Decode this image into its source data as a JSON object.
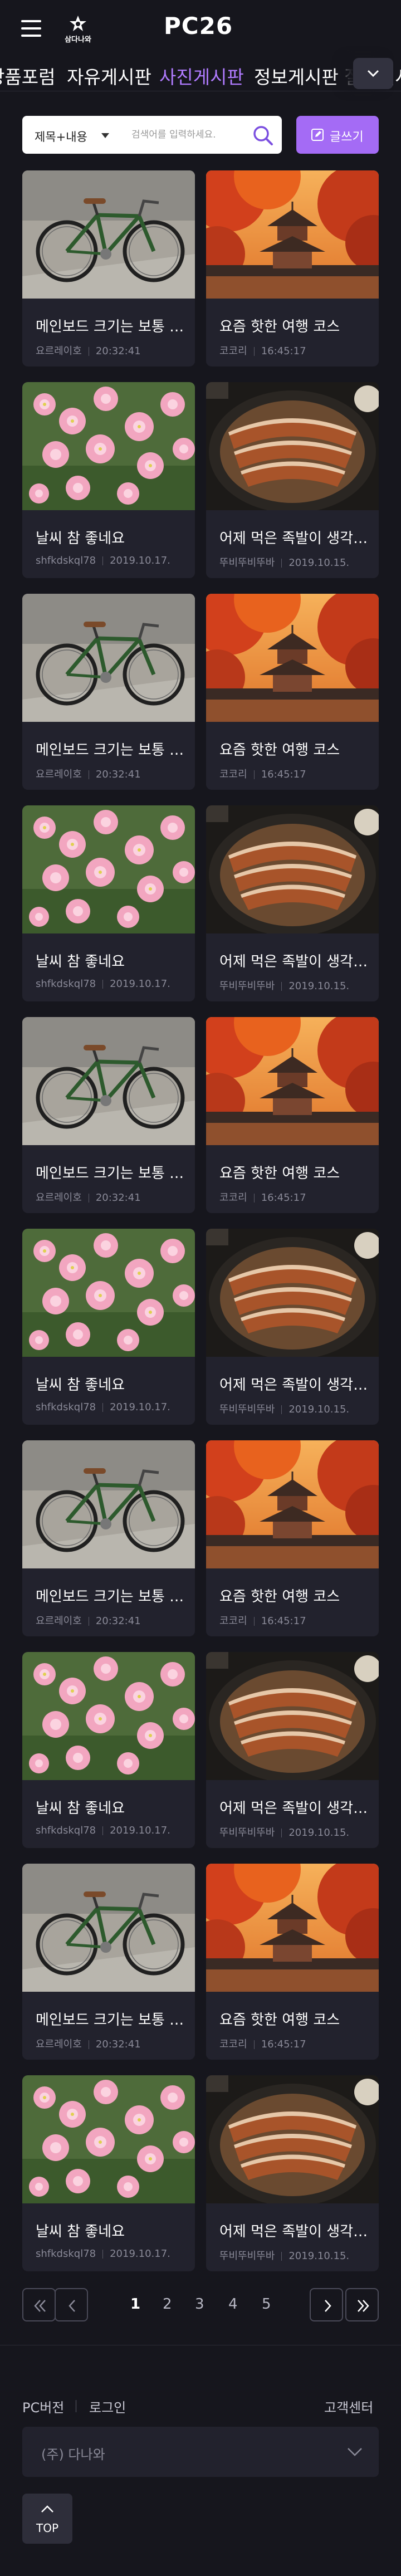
{
  "header": {
    "logo_text": "삼다나와",
    "brand": "PC26",
    "menu_icon": "hamburger-menu-icon",
    "logo_icon": "samdanawa-logo-icon"
  },
  "tabs": [
    {
      "label": "상품포럼",
      "active": false
    },
    {
      "label": "자유게시판",
      "active": false
    },
    {
      "label": "사진게시판",
      "active": true
    },
    {
      "label": "정보게시판",
      "active": false
    },
    {
      "label": "질문게시판",
      "active": false
    }
  ],
  "tab_toggle_icon": "chevron-down-icon",
  "search": {
    "select_value": "제목+내용",
    "placeholder": "검색어를 입력하세요.",
    "button_icon": "search-icon"
  },
  "write_button": {
    "label": "글쓰기",
    "icon": "pencil-icon"
  },
  "posts": [
    {
      "title": "메인보드 크기는 보통 어느 정도인가요",
      "author": "요르레이호",
      "date": "20:32:41",
      "image": "bicycle"
    },
    {
      "title": "요즘 핫한 여행 코스",
      "author": "코코리",
      "date": "16:45:17",
      "image": "autumn-pagoda"
    },
    {
      "title": "날씨 참 좋네요",
      "author": "shfkdskql78",
      "date": "2019.10.17.",
      "image": "pink-flowers"
    },
    {
      "title": "어제 먹은 족발이 생각나네요",
      "author": "뚜비뚜비뚜바",
      "date": "2019.10.15.",
      "image": "jokbal"
    },
    {
      "title": "메인보드 크기는 보통 어느 정도인가요",
      "author": "요르레이호",
      "date": "20:32:41",
      "image": "bicycle"
    },
    {
      "title": "요즘 핫한 여행 코스",
      "author": "코코리",
      "date": "16:45:17",
      "image": "autumn-pagoda"
    },
    {
      "title": "날씨 참 좋네요",
      "author": "shfkdskql78",
      "date": "2019.10.17.",
      "image": "pink-flowers"
    },
    {
      "title": "어제 먹은 족발이 생각나네요",
      "author": "뚜비뚜비뚜바",
      "date": "2019.10.15.",
      "image": "jokbal"
    },
    {
      "title": "메인보드 크기는 보통 어느 정도인가요",
      "author": "요르레이호",
      "date": "20:32:41",
      "image": "bicycle"
    },
    {
      "title": "요즘 핫한 여행 코스",
      "author": "코코리",
      "date": "16:45:17",
      "image": "autumn-pagoda"
    },
    {
      "title": "날씨 참 좋네요",
      "author": "shfkdskql78",
      "date": "2019.10.17.",
      "image": "pink-flowers"
    },
    {
      "title": "어제 먹은 족발이 생각나네요",
      "author": "뚜비뚜비뚜바",
      "date": "2019.10.15.",
      "image": "jokbal"
    },
    {
      "title": "메인보드 크기는 보통 어느 정도인가요",
      "author": "요르레이호",
      "date": "20:32:41",
      "image": "bicycle"
    },
    {
      "title": "요즘 핫한 여행 코스",
      "author": "코코리",
      "date": "16:45:17",
      "image": "autumn-pagoda"
    },
    {
      "title": "날씨 참 좋네요",
      "author": "shfkdskql78",
      "date": "2019.10.17.",
      "image": "pink-flowers"
    },
    {
      "title": "어제 먹은 족발이 생각나네요",
      "author": "뚜비뚜비뚜바",
      "date": "2019.10.15.",
      "image": "jokbal"
    },
    {
      "title": "메인보드 크기는 보통 어느 정도인가요",
      "author": "요르레이호",
      "date": "20:32:41",
      "image": "bicycle"
    },
    {
      "title": "요즘 핫한 여행 코스",
      "author": "코코리",
      "date": "16:45:17",
      "image": "autumn-pagoda"
    },
    {
      "title": "날씨 참 좋네요",
      "author": "shfkdskql78",
      "date": "2019.10.17.",
      "image": "pink-flowers"
    },
    {
      "title": "어제 먹은 족발이 생각나네요",
      "author": "뚜비뚜비뚜바",
      "date": "2019.10.15.",
      "image": "jokbal"
    }
  ],
  "pagination": {
    "pages": [
      "1",
      "2",
      "3",
      "4",
      "5"
    ],
    "current": "1",
    "first_icon": "double-chevron-left-icon",
    "prev_icon": "chevron-left-icon",
    "next_icon": "chevron-right-icon",
    "last_icon": "double-chevron-right-icon"
  },
  "footer": {
    "pc_version": "PC버전",
    "login": "로그인",
    "customer_center": "고객센터",
    "company": "(주) 다나와",
    "company_icon": "chevron-down-icon",
    "top_label": "TOP",
    "top_icon": "chevron-up-icon"
  },
  "colors": {
    "background": "#16161d",
    "card": "#22222d",
    "accent": "#a46bf5",
    "active_tab": "#b07bff"
  }
}
